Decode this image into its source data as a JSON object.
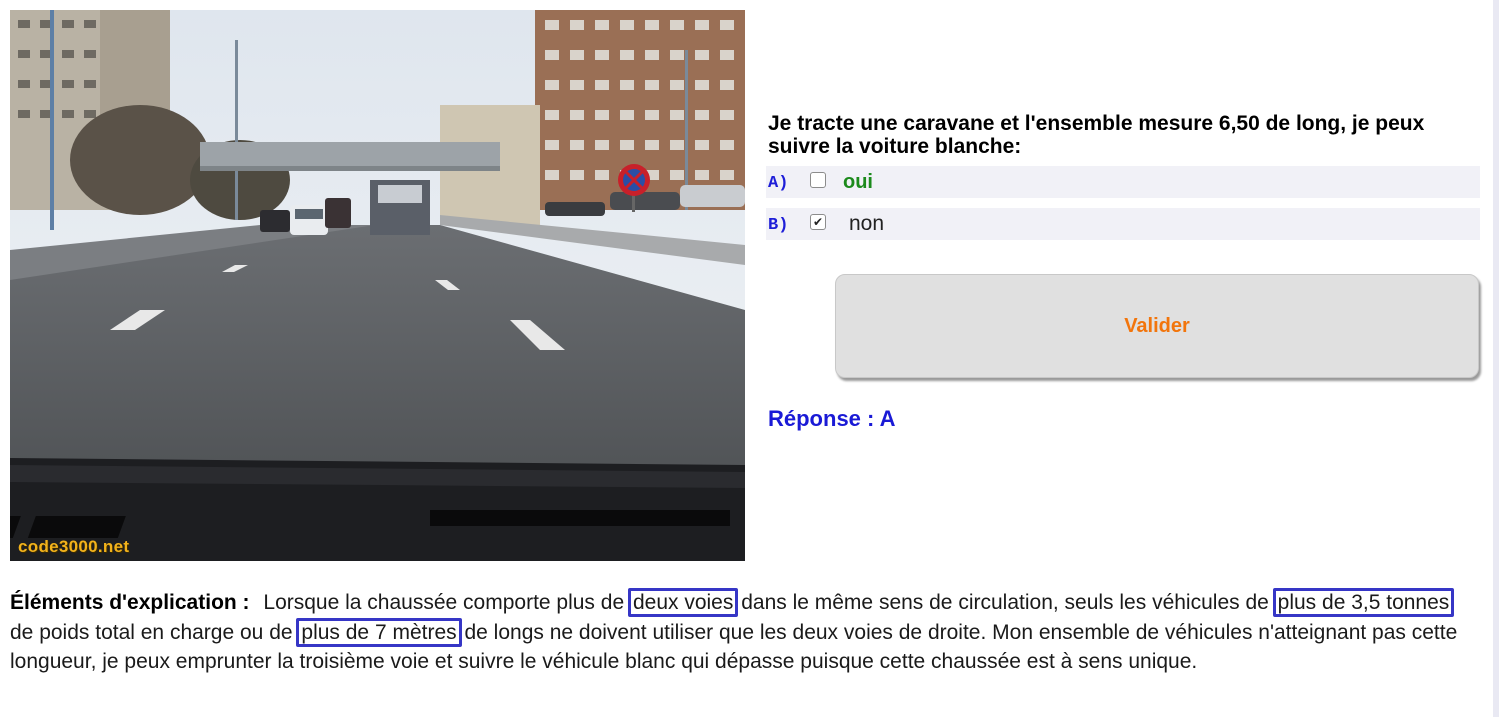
{
  "scene": {
    "watermark": "code3000.net",
    "icon": "no-parking-sign-icon"
  },
  "question": {
    "text": "Je tracte une caravane et l'ensemble mesure 6,50 de long, je peux suivre la voiture blanche:",
    "answers": [
      {
        "letter": "A)",
        "label": "oui",
        "checked": false,
        "color": "#1c8a1c"
      },
      {
        "letter": "B)",
        "label": "non",
        "checked": true,
        "color": "#222222"
      }
    ]
  },
  "validate_button": {
    "label": "Valider",
    "color": "#f2750c"
  },
  "response": {
    "text": "Réponse : A",
    "color": "#1a1ad6"
  },
  "explanation": {
    "title": "Éléments d'explication :",
    "segments": [
      {
        "text": "Lorsque la chaussée comporte plus de ",
        "highlight": false
      },
      {
        "text": "deux voies",
        "highlight": true
      },
      {
        "text": " dans le même sens de circulation, seuls les véhicules de ",
        "highlight": false
      },
      {
        "text": "plus de 3,5 tonnes",
        "highlight": true
      },
      {
        "text": " de poids total en charge ou de ",
        "highlight": false
      },
      {
        "text": "plus de 7 mètres",
        "highlight": true
      },
      {
        "text": " de longs ne doivent utiliser que les deux voies de droite. Mon ensemble de véhicules n'atteignant pas cette longueur, je peux emprunter la troisième voie et suivre le véhicule blanc qui dépasse puisque cette chaussée est à sens unique.",
        "highlight": false
      }
    ],
    "highlight_color": "#3636c6"
  }
}
